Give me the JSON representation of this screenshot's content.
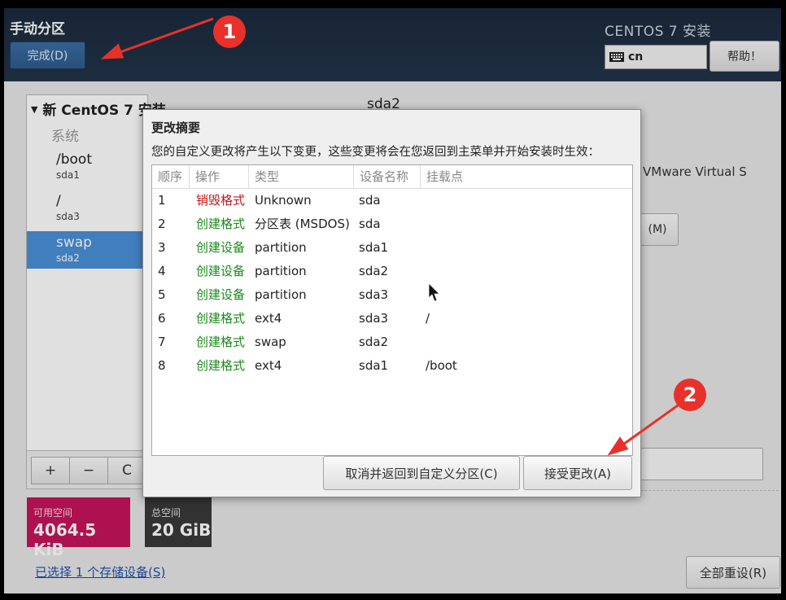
{
  "header": {
    "title": "手动分区",
    "done_button": "完成(D)",
    "product": "CENTOS 7 安装",
    "keyboard_layout": "cn",
    "help_button": "帮助！"
  },
  "left_panel": {
    "heading": "新 CentOS 7 安装",
    "category": "系统",
    "mounts": [
      {
        "name": "/boot",
        "device": "sda1"
      },
      {
        "name": "/",
        "device": "sda3"
      },
      {
        "name": "swap",
        "device": "sda2",
        "selected": true
      }
    ],
    "tool_add": "+",
    "tool_remove": "−",
    "tool_reload": "C"
  },
  "right_panel": {
    "title": "sda2",
    "device_desc": "VMware Virtual S",
    "modify_button": "(M)"
  },
  "space": {
    "available_label": "可用空间",
    "available_value": "4064.5 KiB",
    "total_label": "总空间",
    "total_value": "20 GiB"
  },
  "storage_link": "已选择 1 个存储设备(S)",
  "reset_button": "全部重设(R)",
  "dialog": {
    "title": "更改摘要",
    "description": "您的自定义更改将产生以下变更，这些变更将会在您返回到主菜单并开始安装时生效：",
    "columns": [
      "顺序",
      "操作",
      "类型",
      "设备名称",
      "挂载点"
    ],
    "rows": [
      {
        "order": "1",
        "action": "销毁格式",
        "action_kind": "destroy",
        "type": "Unknown",
        "device": "sda",
        "mount": ""
      },
      {
        "order": "2",
        "action": "创建格式",
        "action_kind": "create",
        "type": "分区表 (MSDOS)",
        "device": "sda",
        "mount": ""
      },
      {
        "order": "3",
        "action": "创建设备",
        "action_kind": "create",
        "type": "partition",
        "device": "sda1",
        "mount": ""
      },
      {
        "order": "4",
        "action": "创建设备",
        "action_kind": "create",
        "type": "partition",
        "device": "sda2",
        "mount": ""
      },
      {
        "order": "5",
        "action": "创建设备",
        "action_kind": "create",
        "type": "partition",
        "device": "sda3",
        "mount": ""
      },
      {
        "order": "6",
        "action": "创建格式",
        "action_kind": "create",
        "type": "ext4",
        "device": "sda3",
        "mount": "/"
      },
      {
        "order": "7",
        "action": "创建格式",
        "action_kind": "create",
        "type": "swap",
        "device": "sda2",
        "mount": ""
      },
      {
        "order": "8",
        "action": "创建格式",
        "action_kind": "create",
        "type": "ext4",
        "device": "sda1",
        "mount": "/boot"
      }
    ],
    "cancel_button": "取消并返回到自定义分区(C)",
    "accept_button": "接受更改(A)"
  },
  "annotations": {
    "badge_1": "1",
    "badge_2": "2",
    "color": "#e8312a"
  },
  "colors": {
    "destroy": "#c41818",
    "create": "#1a8a1a",
    "selected_row": "#4a90d9",
    "available_box": "#c7145a"
  }
}
